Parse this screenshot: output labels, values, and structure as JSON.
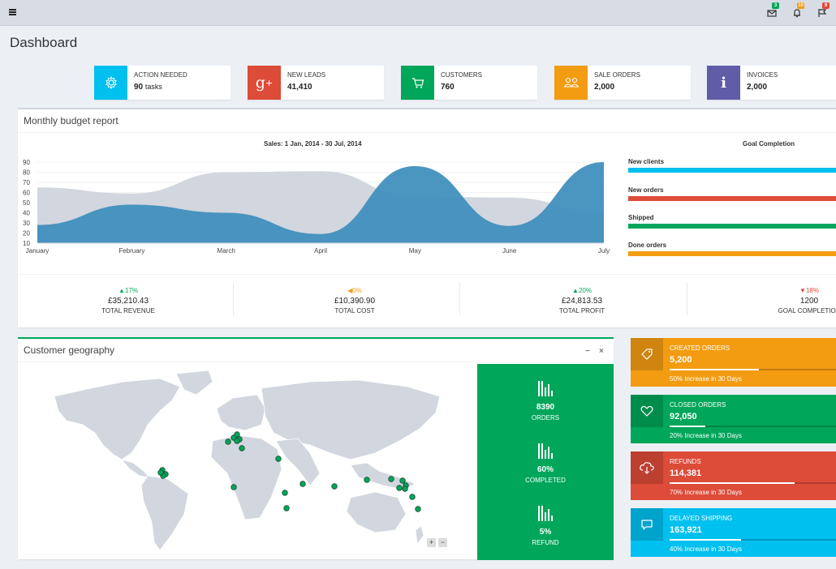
{
  "topbar": {
    "mail_badge": "3",
    "bell_badge": "10",
    "flag_badge": "9"
  },
  "page_title": "Dashboard",
  "info_boxes": [
    {
      "label": "ACTION NEEDED",
      "value": "90",
      "unit": "tasks",
      "color": "#00c0ef",
      "icon": "gear-icon"
    },
    {
      "label": "NEW LEADS",
      "value": "41,410",
      "unit": "",
      "color": "#dd4b39",
      "icon": "google-plus-icon"
    },
    {
      "label": "CUSTOMERS",
      "value": "760",
      "unit": "",
      "color": "#00a65a",
      "icon": "shopping-cart-icon"
    },
    {
      "label": "SALE ORDERS",
      "value": "2,000",
      "unit": "",
      "color": "#f39c12",
      "icon": "users-icon"
    },
    {
      "label": "INVOICES",
      "value": "2,000",
      "unit": "",
      "color": "#605ca8",
      "icon": "info-icon"
    }
  ],
  "budget": {
    "title": "Monthly budget report",
    "goal_title": "Goal Completion",
    "goals": [
      {
        "label": "New clients",
        "color": "#00c0ef"
      },
      {
        "label": "New orders",
        "color": "#dd4b39"
      },
      {
        "label": "Shipped",
        "color": "#00a65a"
      },
      {
        "label": "Done orders",
        "color": "#f39c12"
      }
    ],
    "stats": [
      {
        "pct": "17%",
        "dir": "up",
        "value": "£35,210.43",
        "label": "TOTAL REVENUE",
        "color": "#00a65a"
      },
      {
        "pct": "0%",
        "dir": "left",
        "value": "£10,390.90",
        "label": "TOTAL COST",
        "color": "#f39c12"
      },
      {
        "pct": "20%",
        "dir": "up",
        "value": "£24,813.53",
        "label": "TOTAL PROFIT",
        "color": "#00a65a"
      },
      {
        "pct": "18%",
        "dir": "down",
        "value": "1200",
        "label": "GOAL COMPLETION",
        "color": "#dd4b39"
      }
    ]
  },
  "chart_data": {
    "type": "area",
    "title": "Sales: 1 Jan, 2014 - 30 Jul, 2014",
    "categories": [
      "January",
      "February",
      "March",
      "April",
      "May",
      "June",
      "July"
    ],
    "y_ticks": [
      "90",
      "80",
      "70",
      "60",
      "50",
      "40",
      "30",
      "20",
      "10"
    ],
    "ylim": [
      10,
      90
    ],
    "series": [
      {
        "values": [
          65,
          59,
          80,
          81,
          56,
          55,
          40
        ],
        "color": "#d2d6de"
      },
      {
        "values": [
          28,
          48,
          40,
          19,
          86,
          27,
          90
        ],
        "color": "#3c8dbc"
      }
    ]
  },
  "geo": {
    "title": "Customer geography",
    "minus": "−",
    "close": "×",
    "zoom_in": "+",
    "zoom_out": "−",
    "items": [
      {
        "value": "8390",
        "label": "ORDERS"
      },
      {
        "value": "60%",
        "label": "COMPLETED"
      },
      {
        "value": "5%",
        "label": "REFUND"
      }
    ]
  },
  "stat_boxes": [
    {
      "label": "CREATED ORDERS",
      "value": "5,200",
      "desc": "50% Increase in 30 Days",
      "progress": 0.5,
      "color": "#f39c12",
      "icon": "tag-icon"
    },
    {
      "label": "CLOSED ORDERS",
      "value": "92,050",
      "desc": "20% Increase in 30 Days",
      "progress": 0.2,
      "color": "#00a65a",
      "icon": "heart-icon"
    },
    {
      "label": "REFUNDS",
      "value": "114,381",
      "desc": "70% Increase in 30 Days",
      "progress": 0.7,
      "color": "#dd4b39",
      "icon": "cloud-download-icon"
    },
    {
      "label": "DELAYED SHIPPING",
      "value": "163,921",
      "desc": "40% Increase in 30 Days",
      "progress": 0.4,
      "color": "#00c0ef",
      "icon": "comment-icon"
    }
  ]
}
